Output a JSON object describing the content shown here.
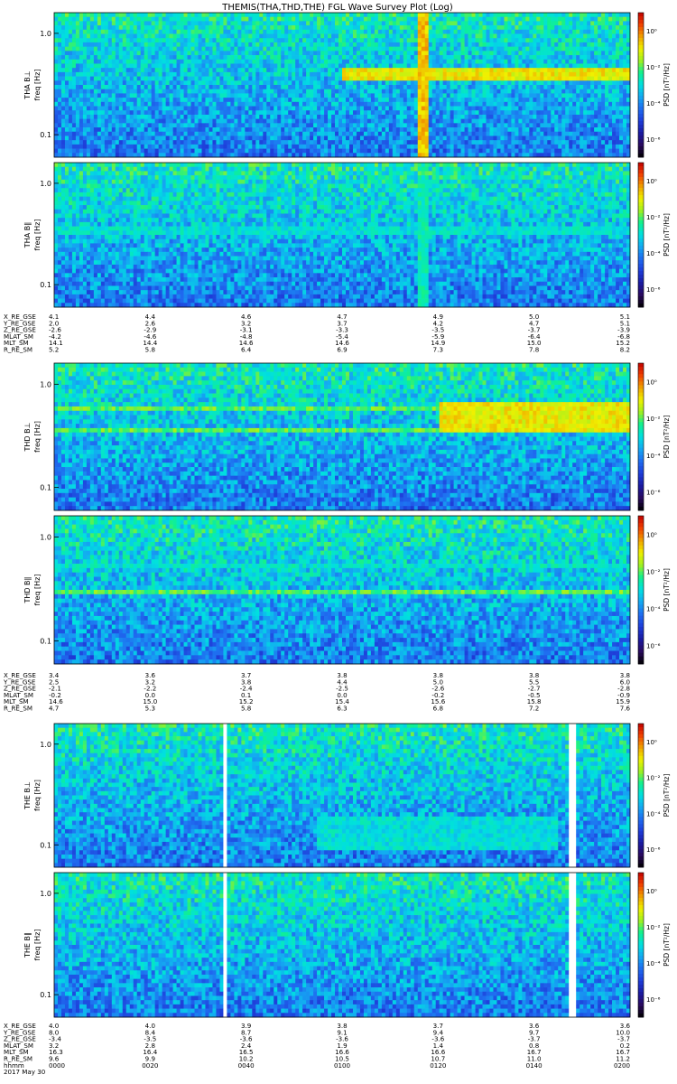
{
  "title": "THEMIS(THA,THD,THE) FGL Wave Survey Plot (Log)",
  "freq_ticks": [
    "1.0",
    "0.1"
  ],
  "freq_tick_values": [
    1.0,
    0.1
  ],
  "freq_axis_label": "freq [Hz]",
  "psd_axis_label": "PSD [nT²/Hz]",
  "colorbar_ticks": [
    "10⁰",
    "10⁻²",
    "10⁻⁴",
    "10⁻⁶"
  ],
  "colorbar_tick_exponents": [
    0,
    -2,
    -4,
    -6
  ],
  "colorscale": [
    "#000000",
    "#2a0a5e",
    "#1a1aa0",
    "#1e3cd8",
    "#1f6cf0",
    "#14a8f2",
    "#00e0e0",
    "#10f090",
    "#a0f020",
    "#f0f000",
    "#f0a000",
    "#f04000",
    "#c00000"
  ],
  "time_label": "hhmm",
  "date_label": "2017 May 30",
  "time_ticks": [
    "0000",
    "0020",
    "0040",
    "0100",
    "0120",
    "0140",
    "0200"
  ],
  "panels": [
    {
      "id": "tha-bl",
      "label": "THA B⊥"
    },
    {
      "id": "tha-bpar",
      "label": "THA B∥"
    },
    {
      "id": "thd-bl",
      "label": "THD B⊥"
    },
    {
      "id": "thd-bpar",
      "label": "THD B∥"
    },
    {
      "id": "the-bl",
      "label": "THE B⊥"
    },
    {
      "id": "the-bpar",
      "label": "THE B∥"
    }
  ],
  "ephemeris": [
    {
      "probe": "THA",
      "rows": [
        {
          "label": "X_RE_GSE",
          "values": [
            "4.1",
            "4.4",
            "4.6",
            "4.7",
            "4.9",
            "5.0",
            "5.1"
          ]
        },
        {
          "label": "Y_RE_GSE",
          "values": [
            "2.0",
            "2.6",
            "3.2",
            "3.7",
            "4.2",
            "4.7",
            "5.1"
          ]
        },
        {
          "label": "Z_RE_GSE",
          "values": [
            "-2.6",
            "-2.9",
            "-3.1",
            "-3.3",
            "-3.5",
            "-3.7",
            "-3.9"
          ]
        },
        {
          "label": "MLAT_SM",
          "values": [
            "-4.2",
            "-4.6",
            "-4.8",
            "-5.4",
            "-5.9",
            "-6.4",
            "-6.8"
          ]
        },
        {
          "label": "MLT_SM",
          "values": [
            "14.1",
            "14.4",
            "14.6",
            "14.6",
            "14.9",
            "15.0",
            "15.2"
          ]
        },
        {
          "label": "R_RE_SM",
          "values": [
            "5.2",
            "5.8",
            "6.4",
            "6.9",
            "7.3",
            "7.8",
            "8.2"
          ]
        }
      ]
    },
    {
      "probe": "THD",
      "rows": [
        {
          "label": "X_RE_GSE",
          "values": [
            "3.4",
            "3.6",
            "3.7",
            "3.8",
            "3.8",
            "3.8",
            "3.8"
          ]
        },
        {
          "label": "Y_RE_GSE",
          "values": [
            "2.5",
            "3.2",
            "3.8",
            "4.4",
            "5.0",
            "5.5",
            "6.0"
          ]
        },
        {
          "label": "Z_RE_GSE",
          "values": [
            "-2.1",
            "-2.2",
            "-2.4",
            "-2.5",
            "-2.6",
            "-2.7",
            "-2.8"
          ]
        },
        {
          "label": "MLAT_SM",
          "values": [
            "-0.2",
            "0.0",
            "0.1",
            "0.0",
            "-0.2",
            "-0.5",
            "-0.9"
          ]
        },
        {
          "label": "MLT_SM",
          "values": [
            "14.6",
            "15.0",
            "15.2",
            "15.4",
            "15.6",
            "15.8",
            "15.9"
          ]
        },
        {
          "label": "R_RE_SM",
          "values": [
            "4.7",
            "5.3",
            "5.8",
            "6.3",
            "6.8",
            "7.2",
            "7.6"
          ]
        }
      ]
    },
    {
      "probe": "THE",
      "rows": [
        {
          "label": "X_RE_GSE",
          "values": [
            "4.0",
            "4.0",
            "3.9",
            "3.8",
            "3.7",
            "3.6",
            "3.6"
          ]
        },
        {
          "label": "Y_RE_GSE",
          "values": [
            "8.0",
            "8.4",
            "8.7",
            "9.1",
            "9.4",
            "9.7",
            "10.0"
          ]
        },
        {
          "label": "Z_RE_GSE",
          "values": [
            "-3.4",
            "-3.5",
            "-3.6",
            "-3.6",
            "-3.6",
            "-3.7",
            "-3.7"
          ]
        },
        {
          "label": "MLAT_SM",
          "values": [
            "3.2",
            "2.8",
            "2.4",
            "1.9",
            "1.4",
            "0.8",
            "0.2"
          ]
        },
        {
          "label": "MLT_SM",
          "values": [
            "16.3",
            "16.4",
            "16.5",
            "16.6",
            "16.6",
            "16.7",
            "16.7"
          ]
        },
        {
          "label": "R_RE_SM",
          "values": [
            "9.6",
            "9.9",
            "10.2",
            "10.5",
            "10.7",
            "11.0",
            "11.2"
          ]
        }
      ]
    }
  ],
  "chart_data": {
    "type": "heatmap",
    "title": "THEMIS(THA,THD,THE) FGL Wave Survey Plot (Log)",
    "xlabel": "hhmm",
    "x_ticks": [
      "0000",
      "0020",
      "0040",
      "0100",
      "0120",
      "0140",
      "0200"
    ],
    "xlim": [
      "0000",
      "0200"
    ],
    "ylabel": "freq [Hz]",
    "yscale": "log",
    "ylim": [
      0.06,
      1.6
    ],
    "zlabel": "PSD [nT²/Hz]",
    "zscale": "log",
    "zlim": [
      1e-07,
      10
    ],
    "panels": [
      {
        "name": "THA B⊥",
        "gaps": [],
        "bands": [
          {
            "freq": [
              0.33,
              0.45
            ],
            "t": [
              "0100",
              "0200"
            ],
            "log_psd": -1
          }
        ],
        "events": [
          {
            "t": "0117",
            "log_psd": 0
          }
        ]
      },
      {
        "name": "THA B∥",
        "gaps": [],
        "bands": [
          {
            "freq": [
              0.3,
              0.36
            ],
            "t": [
              "0000",
              "0200"
            ],
            "log_psd": -3
          }
        ],
        "events": [
          {
            "t": "0117",
            "log_psd": -2
          }
        ]
      },
      {
        "name": "THD B⊥",
        "gaps": [],
        "bands": [
          {
            "freq": [
              0.35,
              0.7
            ],
            "t": [
              "0120",
              "0200"
            ],
            "log_psd": -1
          },
          {
            "freq": [
              0.34,
              0.38
            ],
            "t": [
              "0000",
              "0120"
            ],
            "log_psd": -2
          },
          {
            "freq": [
              0.55,
              0.6
            ],
            "t": [
              "0000",
              "0120"
            ],
            "log_psd": -2
          }
        ],
        "events": []
      },
      {
        "name": "THD B∥",
        "gaps": [],
        "bands": [
          {
            "freq": [
              0.28,
              0.32
            ],
            "t": [
              "0000",
              "0200"
            ],
            "log_psd": -2
          },
          {
            "freq": [
              0.5,
              0.55
            ],
            "t": [
              "0000",
              "0200"
            ],
            "log_psd": -3
          }
        ],
        "events": []
      },
      {
        "name": "THE B⊥",
        "gaps": [
          [
            "0035",
            "0036"
          ],
          [
            "0147",
            "0149"
          ]
        ],
        "bands": [
          {
            "freq": [
              0.09,
              0.2
            ],
            "t": [
              "0055",
              "0145"
            ],
            "log_psd": -3
          }
        ],
        "events": []
      },
      {
        "name": "THE B∥",
        "gaps": [
          [
            "0035",
            "0036"
          ],
          [
            "0147",
            "0149"
          ]
        ],
        "bands": [
          {
            "freq": [
              0.23,
              0.28
            ],
            "t": [
              "0000",
              "0200"
            ],
            "log_psd": -4
          }
        ],
        "events": []
      }
    ]
  }
}
